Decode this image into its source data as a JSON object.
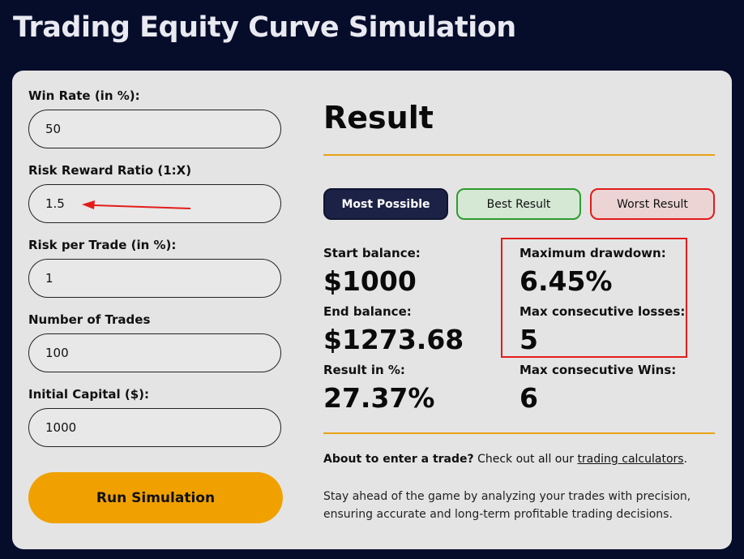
{
  "page": {
    "title": "Trading Equity Curve Simulation"
  },
  "form": {
    "win_rate": {
      "label": "Win Rate (in %):",
      "value": "50"
    },
    "risk_reward": {
      "label": "Risk Reward Ratio (1:X)",
      "value": "1.5"
    },
    "risk_per_trade": {
      "label": "Risk per Trade (in %):",
      "value": "1"
    },
    "num_trades": {
      "label": "Number of Trades",
      "value": "100"
    },
    "initial_capital": {
      "label": "Initial Capital ($):",
      "value": "1000"
    },
    "run_label": "Run Simulation"
  },
  "result": {
    "heading": "Result",
    "tabs": [
      {
        "label": "Most Possible",
        "active": true
      },
      {
        "label": "Best Result",
        "active": false
      },
      {
        "label": "Worst Result",
        "active": false
      }
    ],
    "stats": {
      "start_balance": {
        "label": "Start balance:",
        "value": "$1000"
      },
      "end_balance": {
        "label": "End balance:",
        "value": "$1273.68"
      },
      "result_pct": {
        "label": "Result in %:",
        "value": "27.37%"
      },
      "max_drawdown": {
        "label": "Maximum drawdown:",
        "value": "6.45%"
      },
      "max_consec_losses": {
        "label": "Max consecutive losses:",
        "value": "5"
      },
      "max_consec_wins": {
        "label": "Max consecutive Wins:",
        "value": "6"
      }
    },
    "about": {
      "bold": "About to enter a trade?",
      "text": " Check out all our ",
      "link": "trading calculators",
      "end": "."
    },
    "description": "Stay ahead of the game by analyzing your trades with precision, ensuring accurate and long-term profitable trading decisions."
  },
  "colors": {
    "background": "#060d2b",
    "card": "#e4e4e4",
    "accent": "#f0a100",
    "highlight": "#e51b1b"
  }
}
